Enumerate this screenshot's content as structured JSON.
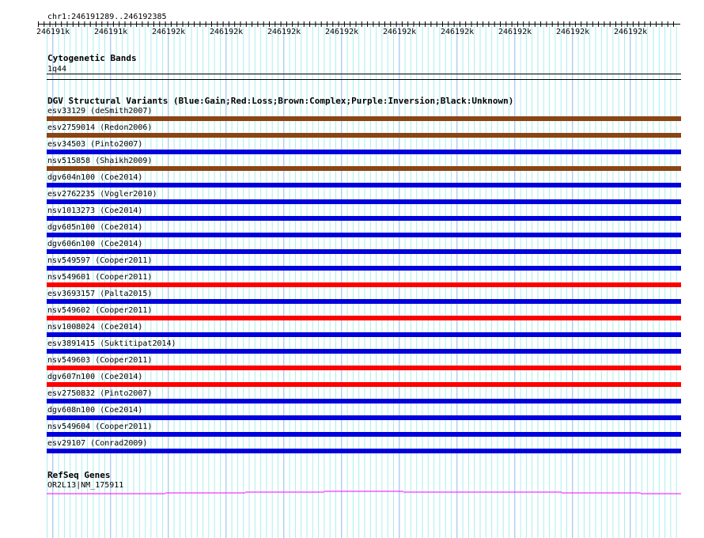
{
  "ruler": {
    "location": "chr1:246191289..246192385",
    "ticks": [
      "246191k",
      "246191k",
      "246192k",
      "246192k",
      "246192k",
      "246192k",
      "246192k",
      "246192k",
      "246192k",
      "246192k",
      "246192k"
    ]
  },
  "cyto": {
    "title": "Cytogenetic Bands",
    "band": "1q44"
  },
  "dgv": {
    "title": "DGV Structural Variants (Blue:Gain;Red:Loss;Brown:Complex;Purple:Inversion;Black:Unknown)",
    "colors": {
      "gain": "#0000dd",
      "loss": "#ff0000",
      "complex": "#8b4513"
    },
    "items": [
      {
        "label": "esv33129 (deSmith2007)",
        "type": "complex"
      },
      {
        "label": "esv2759014 (Redon2006)",
        "type": "complex"
      },
      {
        "label": "esv34503 (Pinto2007)",
        "type": "gain"
      },
      {
        "label": "nsv515858 (Shaikh2009)",
        "type": "complex"
      },
      {
        "label": "dgv604n100 (Coe2014)",
        "type": "gain"
      },
      {
        "label": "esv2762235 (Vogler2010)",
        "type": "gain"
      },
      {
        "label": "nsv1013273 (Coe2014)",
        "type": "gain"
      },
      {
        "label": "dgv605n100 (Coe2014)",
        "type": "gain"
      },
      {
        "label": "dgv606n100 (Coe2014)",
        "type": "gain"
      },
      {
        "label": "nsv549597 (Cooper2011)",
        "type": "gain"
      },
      {
        "label": "nsv549601 (Cooper2011)",
        "type": "loss"
      },
      {
        "label": "esv3693157 (Palta2015)",
        "type": "gain"
      },
      {
        "label": "nsv549602 (Cooper2011)",
        "type": "loss"
      },
      {
        "label": "nsv1008024 (Coe2014)",
        "type": "gain"
      },
      {
        "label": "esv3891415 (Suktitipat2014)",
        "type": "gain"
      },
      {
        "label": "nsv549603 (Cooper2011)",
        "type": "loss"
      },
      {
        "label": "dgv607n100 (Coe2014)",
        "type": "loss"
      },
      {
        "label": "esv2750832 (Pinto2007)",
        "type": "gain"
      },
      {
        "label": "dgv608n100 (Coe2014)",
        "type": "gain"
      },
      {
        "label": "nsv549604 (Cooper2011)",
        "type": "gain"
      },
      {
        "label": "esv29107 (Conrad2009)",
        "type": "gain"
      }
    ]
  },
  "refseq": {
    "title": "RefSeq Genes",
    "gene": "OR2L13|NM_175911",
    "color": "#ff00ff"
  }
}
